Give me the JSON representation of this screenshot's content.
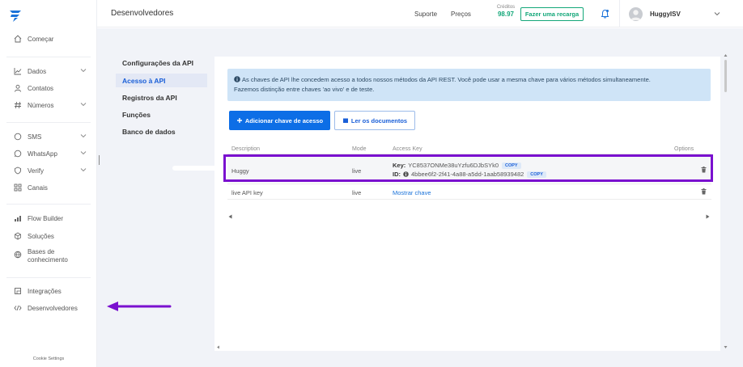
{
  "sidebar": {
    "items": [
      {
        "label": "Começar",
        "icon": "home-icon"
      },
      {
        "label": "Dados",
        "icon": "chart-icon"
      },
      {
        "label": "Contatos",
        "icon": "person-icon"
      },
      {
        "label": "Números",
        "icon": "hash-icon"
      },
      {
        "label": "SMS",
        "icon": "chat-icon"
      },
      {
        "label": "WhatsApp",
        "icon": "whatsapp-icon"
      },
      {
        "label": "Verify",
        "icon": "shield-check-icon"
      },
      {
        "label": "Canais",
        "icon": "grid-icon"
      },
      {
        "label": "Flow Builder",
        "icon": "flow-icon"
      },
      {
        "label": "Soluções",
        "icon": "box-icon"
      },
      {
        "label": "Bases de conhecimento",
        "icon": "globe-icon"
      },
      {
        "label": "Integrações",
        "icon": "puzzle-icon"
      },
      {
        "label": "Desenvolvedores",
        "icon": "code-icon"
      }
    ],
    "cookie_settings": "Cookie Settings"
  },
  "topbar": {
    "title": "Desenvolvedores",
    "support": "Suporte",
    "prices": "Preços",
    "credits_label": "Créditos",
    "credits_value": "98.97",
    "recharge": "Fazer uma recarga",
    "username": "HuggyISV"
  },
  "subnav": {
    "items": [
      {
        "label": "Configurações da API",
        "active": false
      },
      {
        "label": "Acesso à API",
        "active": true
      },
      {
        "label": "Registros da API",
        "active": false
      },
      {
        "label": "Funções",
        "active": false
      },
      {
        "label": "Banco de dados",
        "active": false
      }
    ]
  },
  "info": {
    "line1": "As chaves de API lhe concedem acesso a todos nossos métodos da API REST. Você pode usar a mesma chave para vários métodos simultaneamente.",
    "line2": "Fazemos distinção entre chaves 'ao vivo' e de teste."
  },
  "buttons": {
    "add_key": "Adicionar chave de acesso",
    "read_docs": "Ler os documentos"
  },
  "table": {
    "headers": {
      "description": "Description",
      "mode": "Mode",
      "access_key": "Access Key",
      "options": "Options"
    },
    "rows": [
      {
        "description": "Huggy",
        "mode": "live",
        "key_label": "Key:",
        "key": "YC8537ONMe38uYzfu6DJbSYk0",
        "id_label": "ID:",
        "id": "4bbee6f2-2f41-4a88-a5dd-1aab58939482",
        "copy": "COPY"
      },
      {
        "description": "live API key",
        "mode": "live",
        "show_key": "Mostrar chave"
      }
    ]
  },
  "colors": {
    "primary": "#0d6ee6",
    "accent_green": "#13a779",
    "highlight": "#7a10cf",
    "info_bg": "#cfe4f7"
  }
}
